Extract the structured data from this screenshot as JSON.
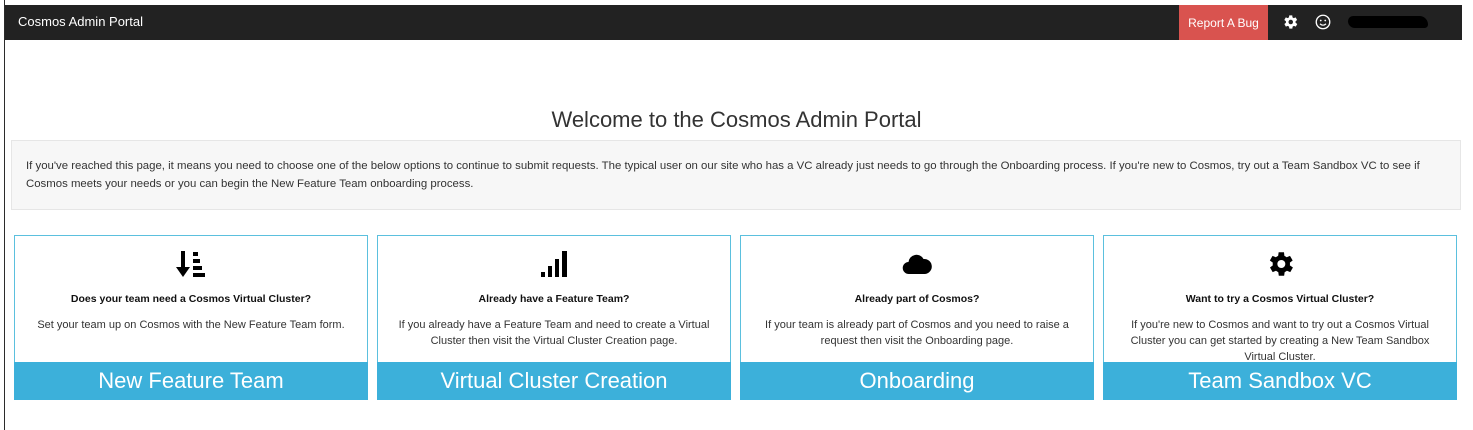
{
  "navbar": {
    "brand": "Cosmos Admin Portal",
    "report_bug_label": "Report A Bug",
    "icons": [
      "gear-icon",
      "smiley-icon"
    ],
    "user_name": "",
    "accent_color": "#d9534f",
    "bar_color": "#222222"
  },
  "main": {
    "heading": "Welcome to the Cosmos Admin Portal",
    "intro": "If you've reached this page, it means you need to choose one of the below options to continue to submit requests. The typical user on our site who has a VC already just needs to go through the Onboarding process. If you're new to Cosmos, try out a Team Sandbox VC to see if Cosmos meets your needs or you can begin the New Feature Team onboarding process."
  },
  "cards": [
    {
      "icon": "sort-descending-icon",
      "title": "Does your team need a Cosmos Virtual Cluster?",
      "description": "Set your team up on Cosmos with the New Feature Team form.",
      "button": "New Feature Team"
    },
    {
      "icon": "signal-bars-icon",
      "title": "Already have a Feature Team?",
      "description": "If you already have a Feature Team and need to create a Virtual Cluster then visit the Virtual Cluster Creation page.",
      "button": "Virtual Cluster Creation"
    },
    {
      "icon": "cloud-icon",
      "title": "Already part of Cosmos?",
      "description": "If your team is already part of Cosmos and you need to raise a request then visit the Onboarding page.",
      "button": "Onboarding"
    },
    {
      "icon": "gear-icon",
      "title": "Want to try a Cosmos Virtual Cluster?",
      "description": "If you're new to Cosmos and want to try out a Cosmos Virtual Cluster you can get started by creating a New Team Sandbox Virtual Cluster.",
      "button": "Team Sandbox VC"
    }
  ],
  "colors": {
    "card_border": "#5bc0de",
    "card_button": "#3cb0da"
  }
}
